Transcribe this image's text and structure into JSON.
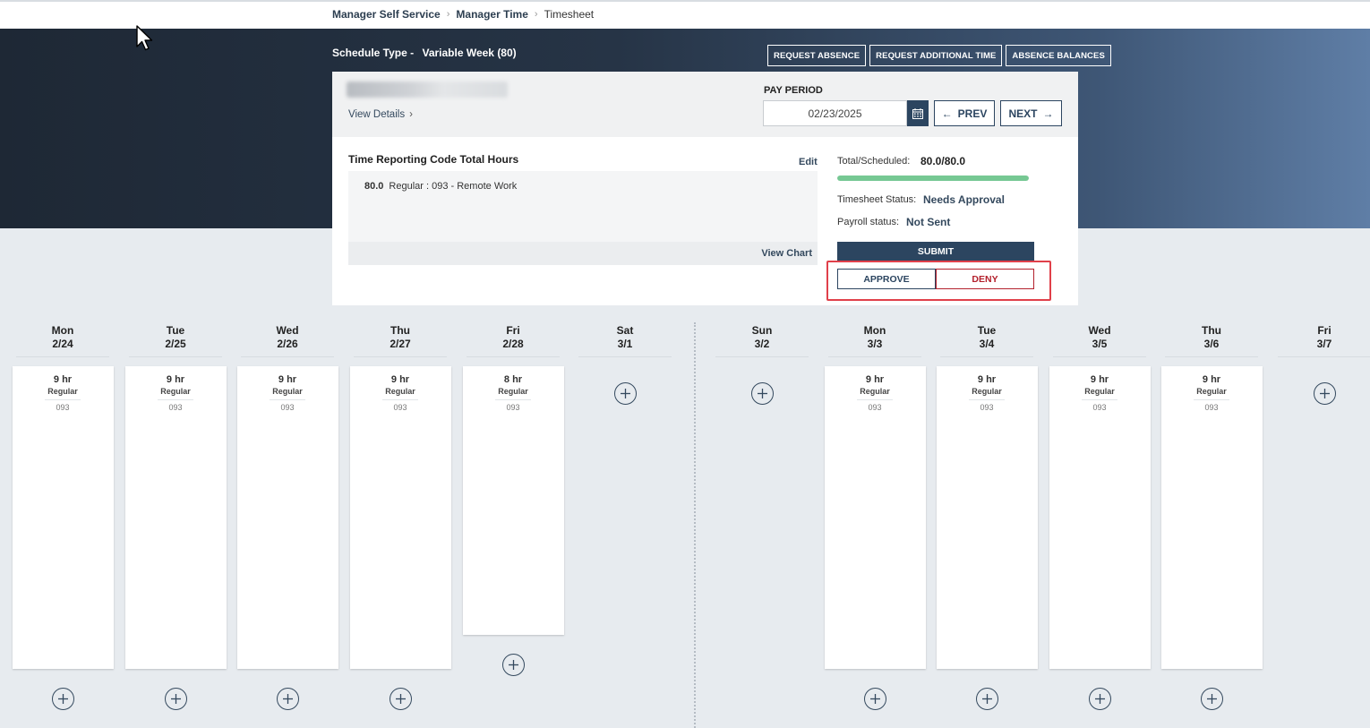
{
  "breadcrumb": {
    "items": [
      "Manager Self Service",
      "Manager Time"
    ],
    "current": "Timesheet"
  },
  "header": {
    "schedule_label": "Schedule Type -",
    "schedule_value": "Variable Week (80)",
    "buttons": [
      "REQUEST ABSENCE",
      "REQUEST ADDITIONAL TIME",
      "ABSENCE BALANCES"
    ]
  },
  "employee": {
    "view_details": "View Details"
  },
  "pay_period": {
    "label": "PAY PERIOD",
    "date": "02/23/2025",
    "prev": "PREV",
    "next": "NEXT"
  },
  "trc": {
    "title": "Time Reporting Code Total Hours",
    "edit": "Edit",
    "rows": [
      {
        "hours": "80.0",
        "desc": "Regular : 093 - Remote Work"
      }
    ],
    "view_chart": "View Chart"
  },
  "summary": {
    "total_label": "Total/Scheduled:",
    "total_value": "80.0/80.0",
    "progress": 1.0,
    "status_label": "Timesheet Status:",
    "status_value": "Needs Approval",
    "payroll_label": "Payroll status:",
    "payroll_value": "Not Sent",
    "submit": "SUBMIT",
    "approve": "APPROVE",
    "deny": "DENY"
  },
  "days": [
    {
      "day": "Mon",
      "date": "2/24",
      "hours": "9 hr",
      "trc": "Regular",
      "code": "093"
    },
    {
      "day": "Tue",
      "date": "2/25",
      "hours": "9 hr",
      "trc": "Regular",
      "code": "093"
    },
    {
      "day": "Wed",
      "date": "2/26",
      "hours": "9 hr",
      "trc": "Regular",
      "code": "093"
    },
    {
      "day": "Thu",
      "date": "2/27",
      "hours": "9 hr",
      "trc": "Regular",
      "code": "093"
    },
    {
      "day": "Fri",
      "date": "2/28",
      "hours": "8 hr",
      "trc": "Regular",
      "code": "093"
    },
    {
      "day": "Sat",
      "date": "3/1"
    },
    {
      "day": "Sun",
      "date": "3/2"
    },
    {
      "day": "Mon",
      "date": "3/3",
      "hours": "9 hr",
      "trc": "Regular",
      "code": "093"
    },
    {
      "day": "Tue",
      "date": "3/4",
      "hours": "9 hr",
      "trc": "Regular",
      "code": "093"
    },
    {
      "day": "Wed",
      "date": "3/5",
      "hours": "9 hr",
      "trc": "Regular",
      "code": "093"
    },
    {
      "day": "Thu",
      "date": "3/6",
      "hours": "9 hr",
      "trc": "Regular",
      "code": "093"
    },
    {
      "day": "Fri",
      "date": "3/7"
    }
  ],
  "colors": {
    "primary": "#2c4560",
    "deny": "#b3202c",
    "progress": "#76c893",
    "highlight": "#e0404a"
  }
}
